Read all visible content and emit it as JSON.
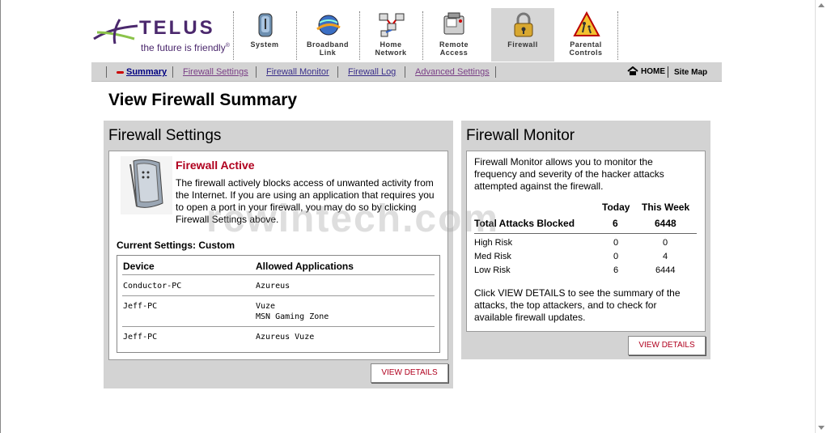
{
  "brand": {
    "name": "TELUS",
    "tagline": "the future is friendly",
    "tagline_mark": "®",
    "color": "#4b286d",
    "accent": "#8bc34a"
  },
  "nav": [
    {
      "label": "System",
      "icon": "system-icon",
      "active": false
    },
    {
      "label": "Broadband\nLink",
      "icon": "broadband-icon",
      "active": false
    },
    {
      "label": "Home\nNetwork",
      "icon": "home-network-icon",
      "active": false
    },
    {
      "label": "Remote\nAccess",
      "icon": "remote-access-icon",
      "active": false
    },
    {
      "label": "Firewall",
      "icon": "padlock-icon",
      "active": true
    },
    {
      "label": "Parental\nControls",
      "icon": "parental-controls-icon",
      "active": false
    }
  ],
  "subnav": {
    "links": [
      {
        "label": "Summary",
        "state": "active"
      },
      {
        "label": "Firewall Settings",
        "state": "visited"
      },
      {
        "label": "Firewall Monitor",
        "state": "normal"
      },
      {
        "label": "Firewall Log",
        "state": "normal"
      },
      {
        "label": "Advanced Settings",
        "state": "visited"
      }
    ],
    "home": "HOME",
    "sitemap": "Site Map"
  },
  "page_title": "View Firewall Summary",
  "settings": {
    "title": "Firewall Settings",
    "status": "Firewall Active",
    "description": "The firewall actively blocks access of unwanted activity from the Internet. If you are using an application that requires you to open a port in your firewall, you may do so by clicking Firewall Settings above.",
    "current": "Current Settings: Custom",
    "col_device": "Device",
    "col_apps": "Allowed Applications",
    "rows": [
      {
        "device": "Conductor-PC",
        "apps": "Azureus"
      },
      {
        "device": "Jeff-PC",
        "apps": "Vuze\nMSN Gaming Zone"
      },
      {
        "device": "Jeff-PC",
        "apps": "Azureus Vuze"
      }
    ],
    "button": "VIEW DETAILS"
  },
  "monitor": {
    "title": "Firewall Monitor",
    "description": "Firewall Monitor allows you to monitor the frequency and severity of the hacker attacks attempted against the firewall.",
    "col_today": "Today",
    "col_week": "This Week",
    "total_label": "Total Attacks Blocked",
    "total_today": "6",
    "total_week": "6448",
    "risks": [
      {
        "label": "High Risk",
        "today": "0",
        "week": "0"
      },
      {
        "label": "Med Risk",
        "today": "0",
        "week": "4"
      },
      {
        "label": "Low Risk",
        "today": "6",
        "week": "6444"
      }
    ],
    "footer": "Click VIEW DETAILS to see the summary of the attacks, the top attackers, and to check for available firewall updates.",
    "button": "VIEW DETAILS"
  },
  "watermark": "rcwintech.com"
}
